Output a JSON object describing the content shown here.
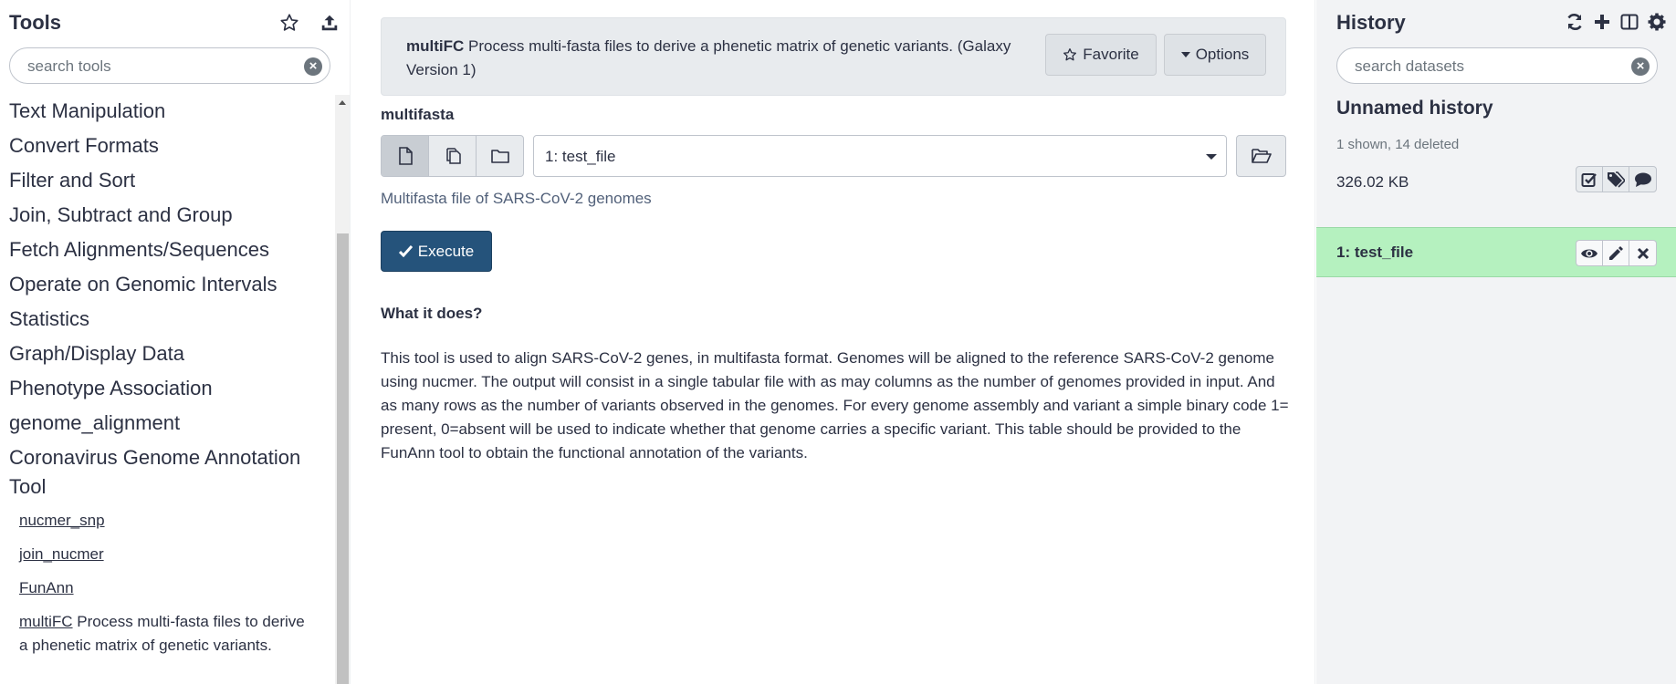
{
  "tools_panel": {
    "title": "Tools",
    "icons": [
      "star-icon",
      "upload-icon"
    ],
    "search_placeholder": "search tools",
    "sections": [
      "Text Manipulation",
      "Convert Formats",
      "Filter and Sort",
      "Join, Subtract and Group",
      "Fetch Alignments/Sequences",
      "Operate on Genomic Intervals",
      "Statistics",
      "Graph/Display Data",
      "Phenotype Association",
      "genome_alignment",
      "Coronavirus Genome Annotation Tool"
    ],
    "tools": [
      {
        "name": "nucmer_snp",
        "desc": ""
      },
      {
        "name": "join_nucmer",
        "desc": ""
      },
      {
        "name": "FunAnn",
        "desc": ""
      },
      {
        "name": "multiFC",
        "desc": "Process multi-fasta files to derive a phenetic matrix of genetic variants."
      }
    ]
  },
  "tool_form": {
    "tool_name": "multiFC",
    "tool_description": "Process multi-fasta files to derive a phenetic matrix of genetic variants. (Galaxy Version 1)",
    "favorite_label": "Favorite",
    "options_label": "Options",
    "param_title": "multifasta",
    "input_value": "1: test_file",
    "input_help": "Multifasta file of SARS-CoV-2 genomes",
    "execute_label": "Execute",
    "help_heading": "What it does?",
    "help_body": "This tool is used to align SARS-CoV-2 genes, in multifasta format. Genomes will be aligned to the reference SARS-CoV-2 genome using nucmer. The output will consist in a single tabular file with as may columns as the number of genomes provided in input. And as many rows as the number of variants observed in the genomes. For every genome assembly and variant a simple binary code 1= present, 0=absent will be used to indicate whether that genome carries a specific variant. This table should be provided to the FunAnn tool to obtain the functional annotation of the variants."
  },
  "history": {
    "title": "History",
    "icons": [
      "refresh-icon",
      "plus-icon",
      "columns-icon",
      "gear-icon"
    ],
    "search_placeholder": "search datasets",
    "name": "Unnamed history",
    "counts": "1 shown, 14 deleted",
    "size": "326.02 KB",
    "datasets": [
      {
        "label": "1: test_file",
        "state_color": "#b5f1bf"
      }
    ]
  }
}
